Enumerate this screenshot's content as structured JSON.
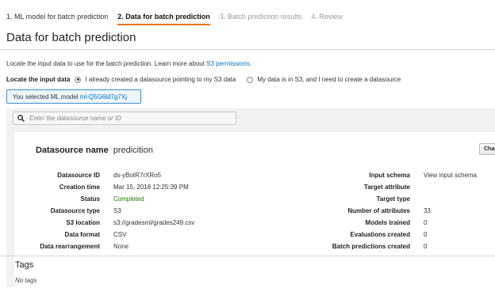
{
  "steps": [
    {
      "label": "1. ML model for batch prediction",
      "state": "done"
    },
    {
      "label": "2. Data for batch prediction",
      "state": "active"
    },
    {
      "label": "3. Batch prediction results",
      "state": "disabled"
    },
    {
      "label": "4. Review",
      "state": "disabled"
    }
  ],
  "page_title": "Data for batch prediction",
  "locate": {
    "text": "Locate the input data to use for the batch prediction. Learn more about ",
    "link": "S3 permissions",
    "link_suffix": ".",
    "label": "Locate the input data",
    "option_existing": "I already created a datasource pointing to my S3 data",
    "option_new": "My data is in S3, and I need to create a datasource"
  },
  "selected": {
    "prefix": "You selected ML model ",
    "model_id": "ml-Q5G6ld7g7Xj"
  },
  "search": {
    "placeholder": "Enter the datasource name or ID"
  },
  "datasource": {
    "name_label": "Datasource name",
    "name_value": "predicition",
    "change_button": "Change",
    "left": [
      {
        "key": "Datasource ID",
        "value": "ds-yBotR7rXRo5",
        "style": "link"
      },
      {
        "key": "Creation time",
        "value": "Mar 15, 2018 12:25:39 PM",
        "style": "plain"
      },
      {
        "key": "Status",
        "value": "Completed",
        "style": "green"
      },
      {
        "key": "Datasource type",
        "value": "S3",
        "style": "plain"
      },
      {
        "key": "S3 location",
        "value": "s3://gradesml/grades249.csv",
        "style": "plain"
      },
      {
        "key": "Data format",
        "value": "CSV",
        "style": "plain"
      },
      {
        "key": "Data rearrangement",
        "value": "None",
        "style": "plain"
      }
    ],
    "right": [
      {
        "key": "Input schema",
        "value": "View input schema",
        "style": "link"
      },
      {
        "key": "Target attribute",
        "value": "",
        "style": "plain"
      },
      {
        "key": "Target type",
        "value": "",
        "style": "plain"
      },
      {
        "key": "Number of attributes",
        "value": "33",
        "style": "plain"
      },
      {
        "key": "Models trained",
        "value": "0",
        "style": "plain"
      },
      {
        "key": "Evaluations created",
        "value": "0",
        "style": "plain"
      },
      {
        "key": "Batch predictions created",
        "value": "0",
        "style": "plain"
      }
    ]
  },
  "tags": {
    "title": "Tags",
    "empty": "No tags"
  },
  "colors": {
    "accent": "#ec7211",
    "link": "#0073bb",
    "status_ok": "#1d8102",
    "selected_border": "#3f8ec9"
  }
}
